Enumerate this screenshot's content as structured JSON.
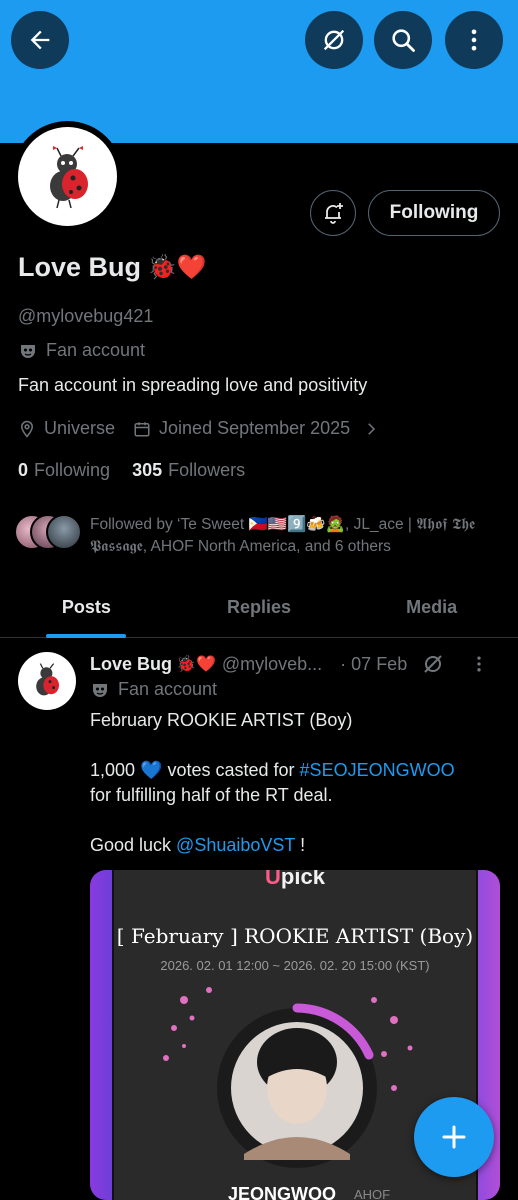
{
  "header": {
    "back_icon": "arrow-left-icon",
    "grok_icon": "grok-icon",
    "search_icon": "search-icon",
    "more_icon": "more-vertical-icon"
  },
  "profile": {
    "name": "Love Bug",
    "name_emojis": "🐞❤️",
    "handle": "@mylovebug421",
    "account_label": "Fan account",
    "bio": "Fan account in spreading love and positivity",
    "location": "Universe",
    "joined": "Joined September 2025",
    "following_count": "0",
    "following_label": "Following",
    "followers_count": "305",
    "followers_label": "Followers",
    "following_button": "Following",
    "followed_by": "Followed by ‘Te Sweet 🇵🇭🇺🇸9️⃣🍻🧟, JL_ace | 𝕬𝖍𝖔𝖋 𝕿𝖍𝖊 𝕻𝖆𝖘𝖘𝖆𝖌𝖊, AHOF North America, and 6 others"
  },
  "tabs": [
    {
      "label": "Posts",
      "active": true
    },
    {
      "label": "Replies",
      "active": false
    },
    {
      "label": "Media",
      "active": false
    }
  ],
  "post": {
    "name": "Love Bug",
    "name_emojis": "🐞❤️",
    "handle": "@myloveb...",
    "date": "· 07 Feb",
    "account_label": "Fan account",
    "line1": "February ROOKIE ARTIST (Boy)",
    "line2_pre": "1,000 ",
    "line2_emoji": "💙",
    "line2_post": " votes casted for ",
    "hashtag": "#SEOJEONGWOO",
    "line3": "for fulfilling half of the RT deal.",
    "line4_pre": "Good luck ",
    "mention": "@ShuaiboVST",
    "line4_post": " !",
    "media": {
      "brand": "Upick",
      "title": "[ February ] ROOKIE ARTIST (Boy)",
      "date_range": "2026. 02. 01 12:00 ~ 2026. 02. 20 15:00 (KST)",
      "artist_name": "JEONGWOO",
      "artist_sub": "AHOF"
    }
  },
  "colors": {
    "accent": "#1d9bf0",
    "background": "#000000",
    "muted": "#71767b",
    "text": "#e7e9ea"
  }
}
